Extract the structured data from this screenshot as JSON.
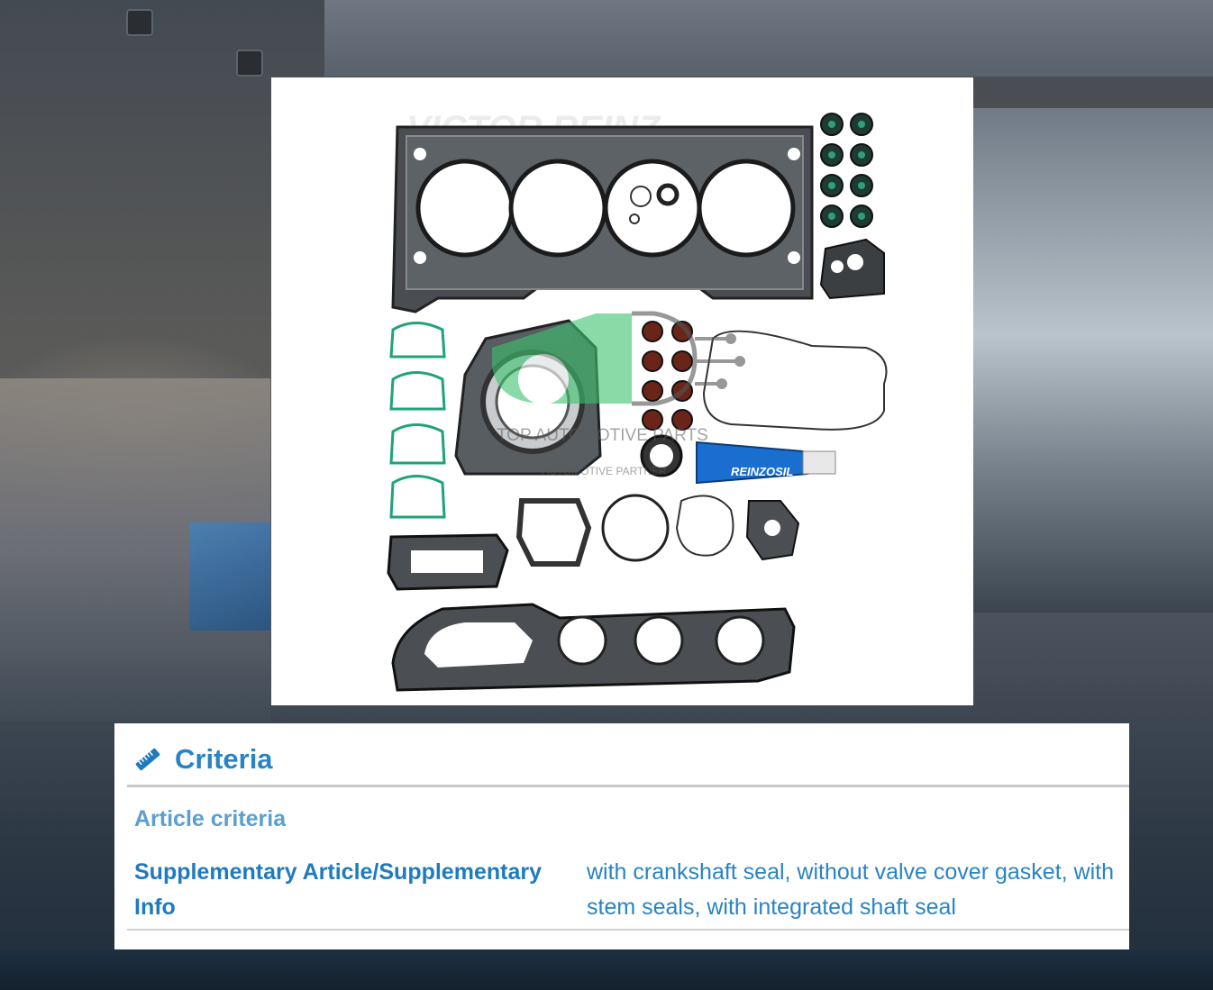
{
  "product_image": {
    "watermark_brand": "VICTOR REINZ",
    "sealant_label": "REINZOSIL",
    "overlay_logo": {
      "line1": "TOP AUTOMOTIVE PARTS",
      "line2": "AUTOMOTIVE PARTNER",
      "color": "#3cc36e"
    }
  },
  "criteria": {
    "icon": "ruler-icon",
    "title": "Criteria",
    "section_title": "Article criteria",
    "rows": [
      {
        "label": "Supplementary Article/Supplementary Info",
        "value": "with crankshaft seal, without valve cover gasket, with stem seals, with integrated shaft seal"
      }
    ]
  },
  "colors": {
    "accent": "#2a83c2",
    "gasket_dark": "#3b3f42",
    "seal_green": "#1f9e7a",
    "seal_red": "#7a2a1e",
    "sealant_blue": "#1a6ed0"
  }
}
